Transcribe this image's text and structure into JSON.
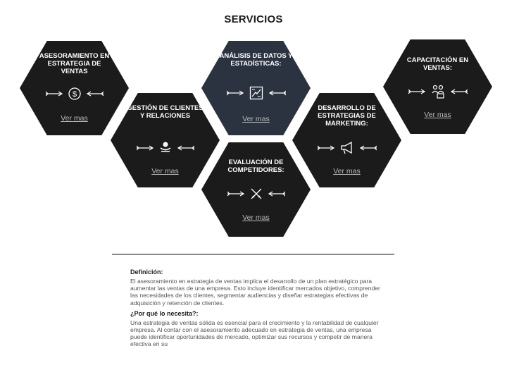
{
  "page": {
    "title": "SERVICIOS"
  },
  "services": [
    {
      "title": "ASESORAMIENTO EN ESTRATEGIA DE VENTAS",
      "link": "Ver mas",
      "icon": "dollar-coin-icon"
    },
    {
      "title": "GESTIÓN DE CLIENTES Y RELACIONES",
      "link": "Ver mas",
      "icon": "client-relations-icon"
    },
    {
      "title": "ANÁLISIS DE DATOS Y ESTADÍSTICAS:",
      "link": "Ver mas",
      "icon": "data-chart-icon"
    },
    {
      "title": "EVALUACIÓN DE COMPETIDORES:",
      "link": "Ver mas",
      "icon": "crossed-swords-icon"
    },
    {
      "title": "DESARROLLO DE ESTRATEGIAS DE MARKETING:",
      "link": "Ver mas",
      "icon": "megaphone-icon"
    },
    {
      "title": "CAPACITACIÓN EN VENTAS:",
      "link": "Ver mas",
      "icon": "team-training-icon"
    }
  ],
  "detail": {
    "definition_heading": "Definición:",
    "definition_text": "El asesoramiento en estrategia de ventas implica el desarrollo de un plan estratégico para aumentar las ventas de una empresa. Esto incluye identificar mercados objetivo, comprender las necesidades de los clientes, segmentar audiencias y diseñar estrategias efectivas de adquisición y retención de clientes.",
    "why_heading": "¿Por qué lo necesita?:",
    "why_text": "Una estrategia de ventas sólida es esencial para el crecimiento y la rentabilidad de cualquier empresa. Al contar con el asesoramiento adecuado en estrategia de ventas, una empresa puede identificar oportunidades de mercado, optimizar sus recursos y competir de manera efectiva en su"
  }
}
